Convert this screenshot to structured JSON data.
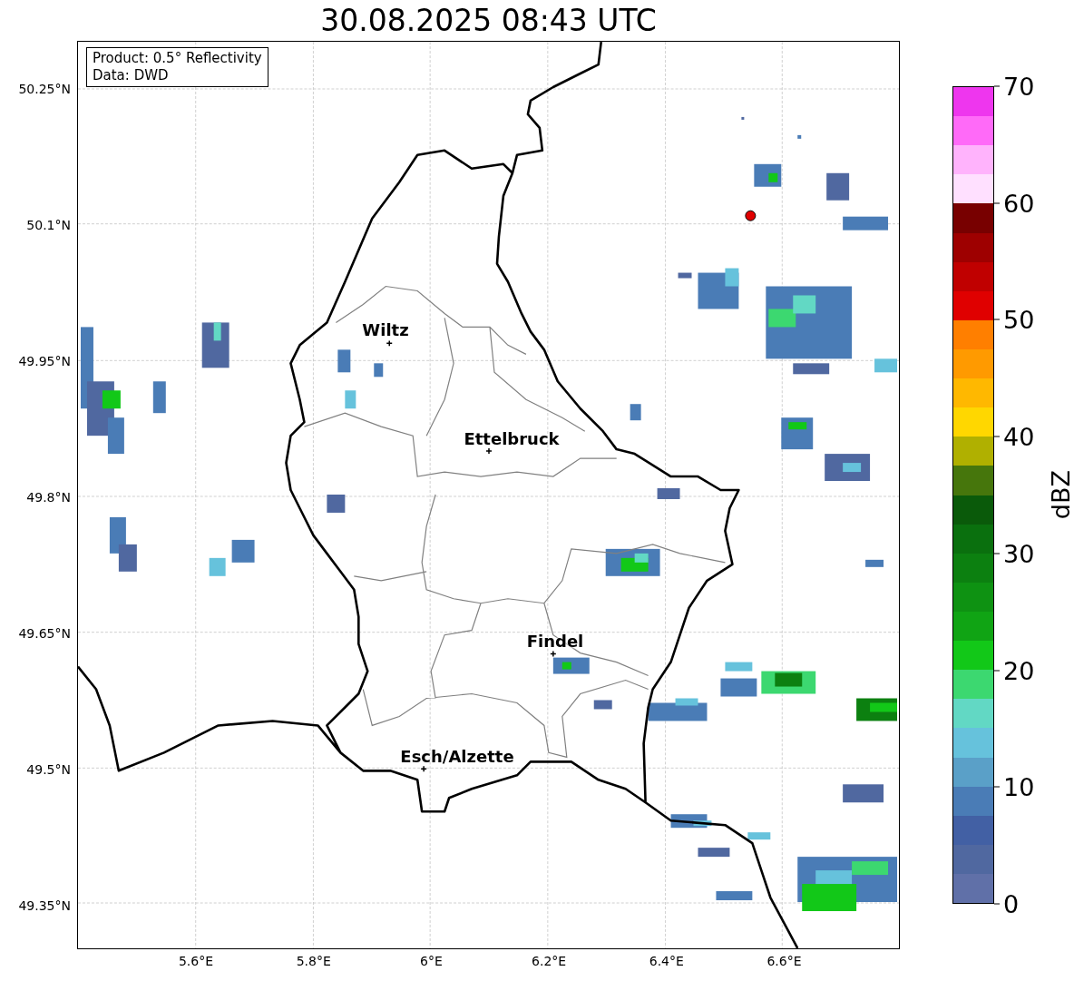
{
  "title": "30.08.2025 08:43 UTC",
  "info_box": {
    "lines": [
      "Product: 0.5° Reflectivity",
      "Data: DWD"
    ]
  },
  "map": {
    "lat_ticks": [
      "50.25°N",
      "50.1°N",
      "49.95°N",
      "49.8°N",
      "49.65°N",
      "49.5°N",
      "49.35°N"
    ],
    "lon_ticks": [
      "5.6°E",
      "5.8°E",
      "6°E",
      "6.2°E",
      "6.4°E",
      "6.6°E"
    ],
    "cities": [
      {
        "name": "Wiltz"
      },
      {
        "name": "Ettelbruck"
      },
      {
        "name": "Findel"
      },
      {
        "name": "Esch/Alzette"
      }
    ]
  },
  "colorbar": {
    "label": "dBZ",
    "ticks": [
      "70",
      "60",
      "50",
      "40",
      "30",
      "20",
      "10",
      "0"
    ],
    "bands": [
      {
        "color": "#ee36ee"
      },
      {
        "color": "#ff6af8"
      },
      {
        "color": "#ffb3fc"
      },
      {
        "color": "#ffe0ff"
      },
      {
        "color": "#780000"
      },
      {
        "color": "#9e0000"
      },
      {
        "color": "#c00000"
      },
      {
        "color": "#e00000"
      },
      {
        "color": "#ff7f00"
      },
      {
        "color": "#ff9a00"
      },
      {
        "color": "#ffb800"
      },
      {
        "color": "#ffd700"
      },
      {
        "color": "#b0b000"
      },
      {
        "color": "#46760c"
      },
      {
        "color": "#0a5a0a"
      },
      {
        "color": "#0a700e"
      },
      {
        "color": "#0c8010"
      },
      {
        "color": "#0e9212"
      },
      {
        "color": "#10a414"
      },
      {
        "color": "#12c818"
      },
      {
        "color": "#3cd870"
      },
      {
        "color": "#62d8c4"
      },
      {
        "color": "#66c2dc"
      },
      {
        "color": "#5aa0c8"
      },
      {
        "color": "#4a7cb6"
      },
      {
        "color": "#4260a4"
      },
      {
        "color": "#5068a0"
      },
      {
        "color": "#6070a8"
      }
    ]
  }
}
